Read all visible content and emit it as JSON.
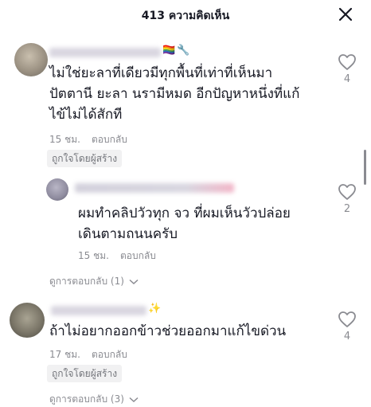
{
  "header": {
    "title": "413 ความคิดเห็น",
    "close_icon": "close-icon"
  },
  "comments": [
    {
      "text_lines": [
        "ไม่ใช่ยะลาที่เดียวมีทุกพื้นที่เท่าที่เห็นมา",
        "ปัตตานี ยะลา นรามีหมด อีกปัญหาหนึ่งที่แก้",
        "ไข้ไม่ได้สักที"
      ],
      "time": "15 ชม.",
      "reply_label": "ตอบกลับ",
      "badge": "ถูกใจโดยผู้สร้าง",
      "likes": "4"
    },
    {
      "text_lines": [
        "ผมทำคลิปวัวทุก จว ที่ผมเห็นวัวปล่อย",
        "เดินตามถนนครับ"
      ],
      "time": "15 ชม.",
      "reply_label": "ตอบกลับ",
      "likes": "2"
    },
    {
      "text_lines": [
        "ถ้าไม่อยากออกข้าวช่วยออกมาแก้ไขด่วน"
      ],
      "time": "17 ชม.",
      "reply_label": "ตอบกลับ",
      "badge": "ถูกใจโดยผู้สร้าง",
      "likes": "4"
    }
  ],
  "view_replies": [
    "ดูการตอบกลับ (1)",
    "ดูการตอบกลับ (3)"
  ],
  "emoji": {
    "rainbow_flag": "🏳️‍🌈",
    "wrench": "🔧",
    "sparkle": "✨"
  }
}
